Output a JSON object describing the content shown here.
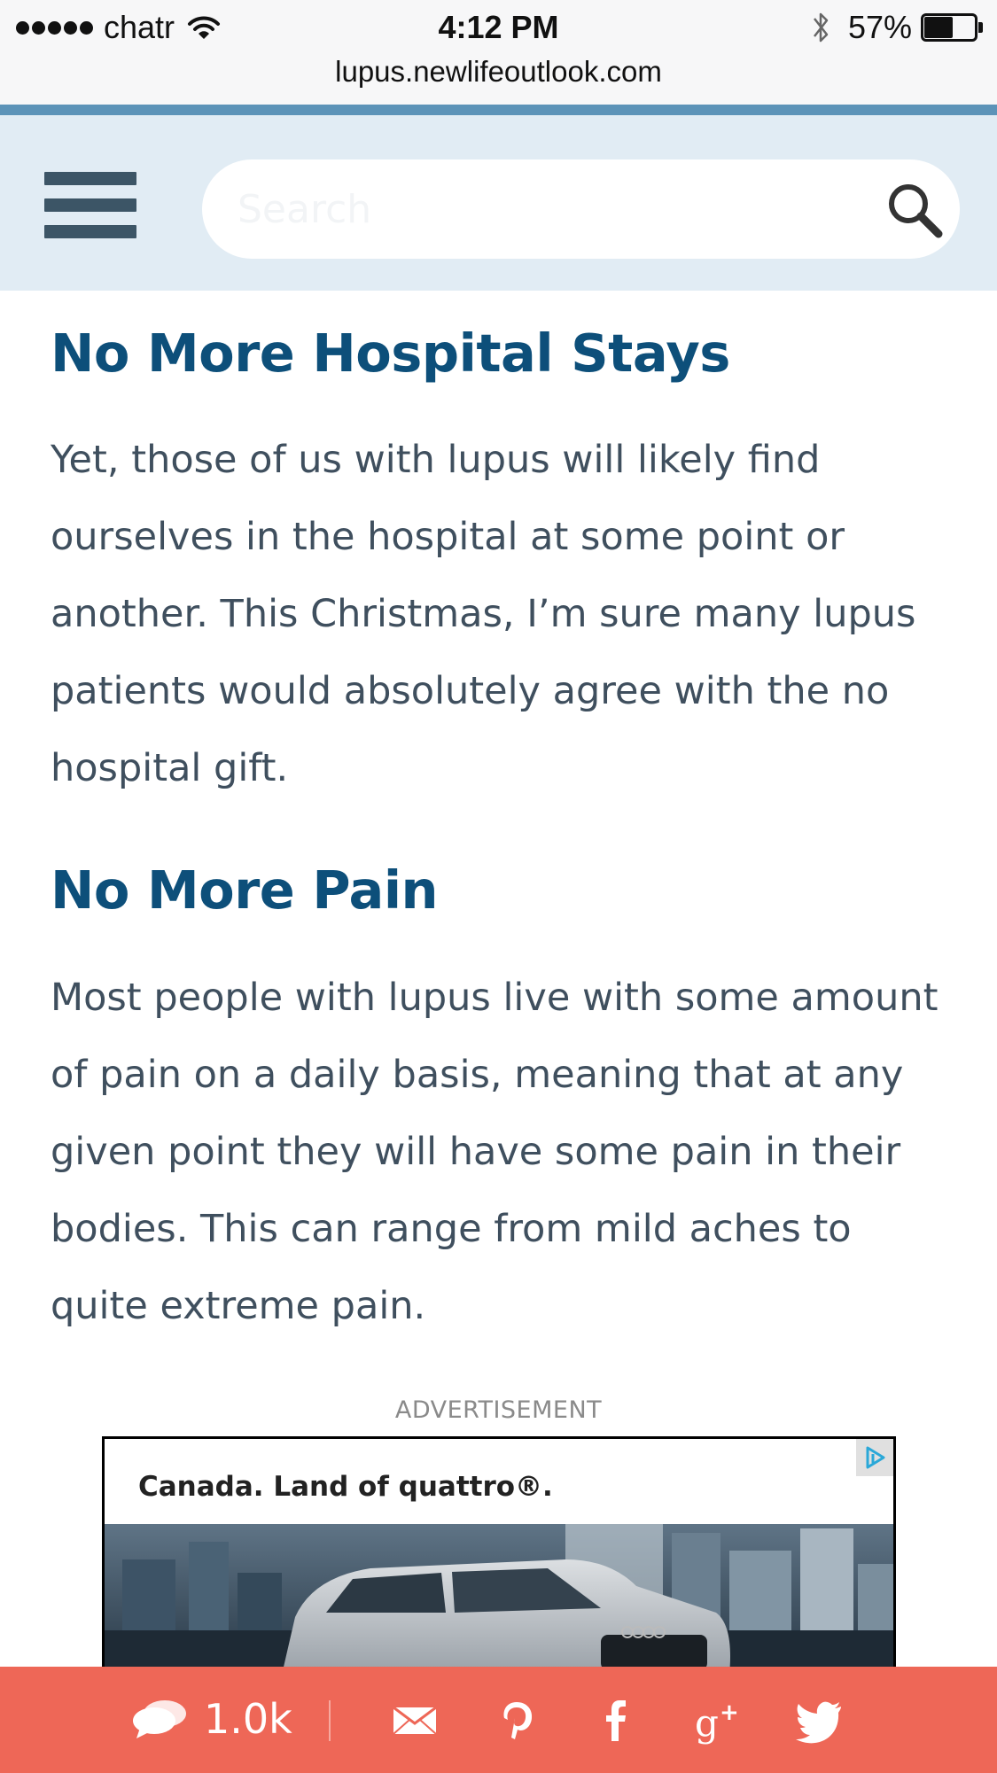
{
  "status_bar": {
    "carrier": "chatr",
    "time": "4:12 PM",
    "battery": "57%",
    "battery_level": 0.57,
    "icons": [
      "signal-dots-icon",
      "wifi-icon",
      "bluetooth-icon",
      "battery-icon"
    ]
  },
  "browser": {
    "url": "lupus.newlifeoutlook.com"
  },
  "header": {
    "menu_icon": "hamburger-menu-icon",
    "search_placeholder": "Search",
    "search_icon": "search-icon",
    "accent_color": "#5c93b8",
    "background_color": "#e1ecf4"
  },
  "article": {
    "sections": [
      {
        "heading": "No More Hospital Stays",
        "body": "Yet, those of us with lupus will likely find ourselves in the hospital at some point or another. This Christmas, I’m sure many lupus patients would absolutely agree with the no hospital gift."
      },
      {
        "heading": "No More Pain",
        "body": "Most people with lupus live with some amount of pain on a daily basis, meaning that at any given point they will have some pain in their bodies. This can range from mild aches to quite extreme pain."
      }
    ],
    "heading_color": "#0d4f7a",
    "body_color": "#3f4f5e"
  },
  "ad": {
    "label": "ADVERTISEMENT",
    "headline": "Canada. Land of quattro®.",
    "choices_icon": "adchoices-icon"
  },
  "share_bar": {
    "comment_count": "1.0k",
    "background_color": "#ee6757",
    "icons": [
      "comment-icon",
      "email-icon",
      "pinterest-icon",
      "facebook-icon",
      "google-plus-icon",
      "twitter-icon"
    ]
  }
}
